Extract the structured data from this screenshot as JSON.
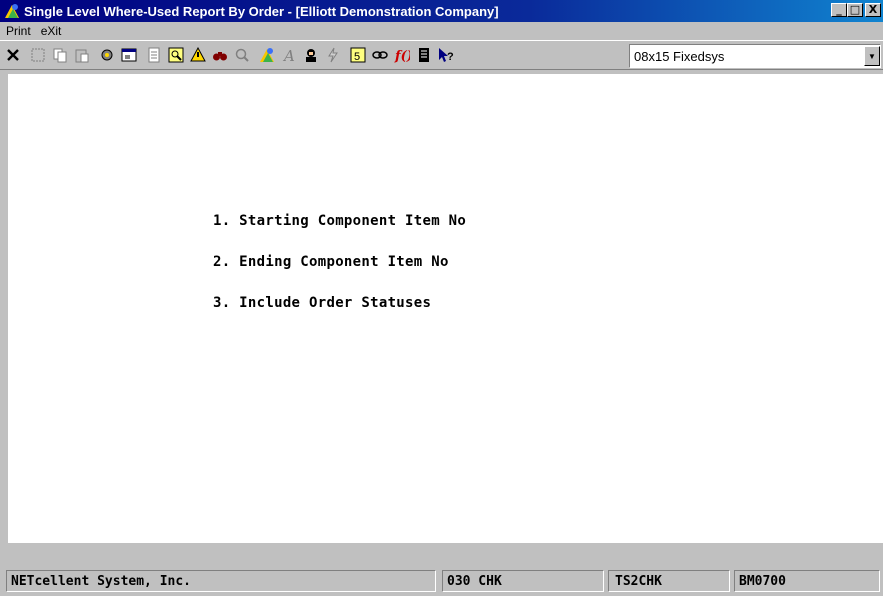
{
  "window": {
    "title": "Single Level Where-Used Report By Order - [Elliott Demonstration Company]",
    "buttons": {
      "minimize": "_",
      "maximize": "□",
      "close": "X"
    }
  },
  "menu": {
    "items": [
      "Print",
      "eXit"
    ]
  },
  "toolbar": {
    "icons": [
      "close-x-icon",
      "select-icon",
      "copy-icon",
      "paste-icon",
      "settings-gear-icon",
      "properties-icon",
      "notes-icon",
      "find-icon",
      "warning-icon",
      "binoculars-icon",
      "zoom-icon",
      "globe-icon",
      "font-icon",
      "user-icon",
      "lightning-icon",
      "calculator-icon",
      "link-icon",
      "function-icon",
      "list-icon",
      "help-pointer-icon"
    ],
    "font_select": {
      "value": "08x15 Fixedsys"
    }
  },
  "screen": {
    "fields": [
      "1. Starting Component Item No",
      "2. Ending Component Item No",
      "3. Include Order Statuses"
    ]
  },
  "status": {
    "company": "NETcellent System, Inc.",
    "terminal": "030 CHK",
    "user": "TS2CHK",
    "program": "BM0700"
  }
}
